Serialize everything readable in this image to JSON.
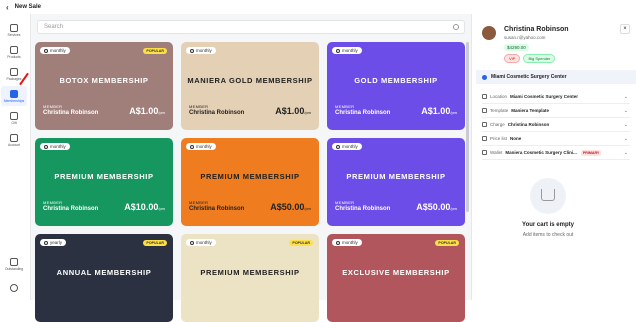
{
  "header": {
    "title": "New Sale"
  },
  "rail": {
    "items": [
      {
        "label": "Services"
      },
      {
        "label": "Products"
      },
      {
        "label": "Packages"
      },
      {
        "label": "Memberships"
      },
      {
        "label": "Gift"
      },
      {
        "label": "Account"
      },
      {
        "label": "Outstanding"
      }
    ]
  },
  "search": {
    "placeholder": "Search"
  },
  "cards": [
    {
      "freq": "monthly",
      "popular": "POPULAR",
      "title": "BOTOX MEMBERSHIP",
      "member_label": "MEMBER",
      "member": "Christina Robinson",
      "price": "A$1.00",
      "per": "/pm",
      "bg": "#a07f7b"
    },
    {
      "freq": "monthly",
      "popular": "",
      "title": "MANIERA GOLD MEMBERSHIP",
      "member_label": "MEMBER",
      "member": "Christina Robinson",
      "price": "A$1.00",
      "per": "/pm",
      "bg": "#e3d0b5",
      "dark": true
    },
    {
      "freq": "monthly",
      "popular": "",
      "title": "GOLD MEMBERSHIP",
      "member_label": "MEMBER",
      "member": "Christina Robinson",
      "price": "A$1.00",
      "per": "/pm",
      "bg": "#6d4de8"
    },
    {
      "freq": "monthly",
      "popular": "",
      "title": "PREMIUM MEMBERSHIP",
      "member_label": "MEMBER",
      "member": "Christina Robinson",
      "price": "A$10.00",
      "per": "/pm",
      "bg": "#15975f"
    },
    {
      "freq": "monthly",
      "popular": "",
      "title": "PREMIUM MEMBERSHIP",
      "member_label": "MEMBER",
      "member": "Christina Robinson",
      "price": "A$50.00",
      "per": "/pm",
      "bg": "#ef7c1f",
      "dark": true
    },
    {
      "freq": "monthly",
      "popular": "",
      "title": "PREMIUM MEMBERSHIP",
      "member_label": "MEMBER",
      "member": "Christina Robinson",
      "price": "A$50.00",
      "per": "/pm",
      "bg": "#6d4de8"
    },
    {
      "freq": "yearly",
      "popular": "POPULAR",
      "title": "ANNUAL MEMBERSHIP",
      "member_label": "",
      "member": "",
      "price": "",
      "per": "",
      "bg": "#2b3140"
    },
    {
      "freq": "monthly",
      "popular": "POPULAR",
      "title": "PREMIUM MEMBERSHIP",
      "member_label": "",
      "member": "",
      "price": "",
      "per": "",
      "bg": "#ece2c4",
      "dark": true
    },
    {
      "freq": "monthly",
      "popular": "POPULAR",
      "title": "EXCLUSIVE MEMBERSHIP",
      "member_label": "",
      "member": "",
      "price": "",
      "per": "",
      "bg": "#b2565d"
    }
  ],
  "client": {
    "name": "Christina Robinson",
    "email": "susan.r@yahoo.com",
    "balance": "$4290.00",
    "badges": [
      "VIP",
      "Big Spender"
    ]
  },
  "location": {
    "label": "Miami Cosmetic Surgery Center"
  },
  "details": [
    {
      "label": "Location",
      "value": "Miami Cosmetic Surgery Center",
      "extra": ""
    },
    {
      "label": "Template",
      "value": "Maniera Template",
      "extra": ""
    },
    {
      "label": "Charge",
      "value": "Christina Robinson",
      "extra": ""
    },
    {
      "label": "Price list",
      "value": "None",
      "extra": ""
    },
    {
      "label": "Wallet",
      "value": "Maniera Cosmetic Surgery Clini...",
      "extra": "PRIMARY"
    }
  ],
  "cart": {
    "empty_title": "Your cart is empty",
    "empty_sub": "Add items to check out"
  },
  "colors": {
    "accent": "#2563eb"
  }
}
